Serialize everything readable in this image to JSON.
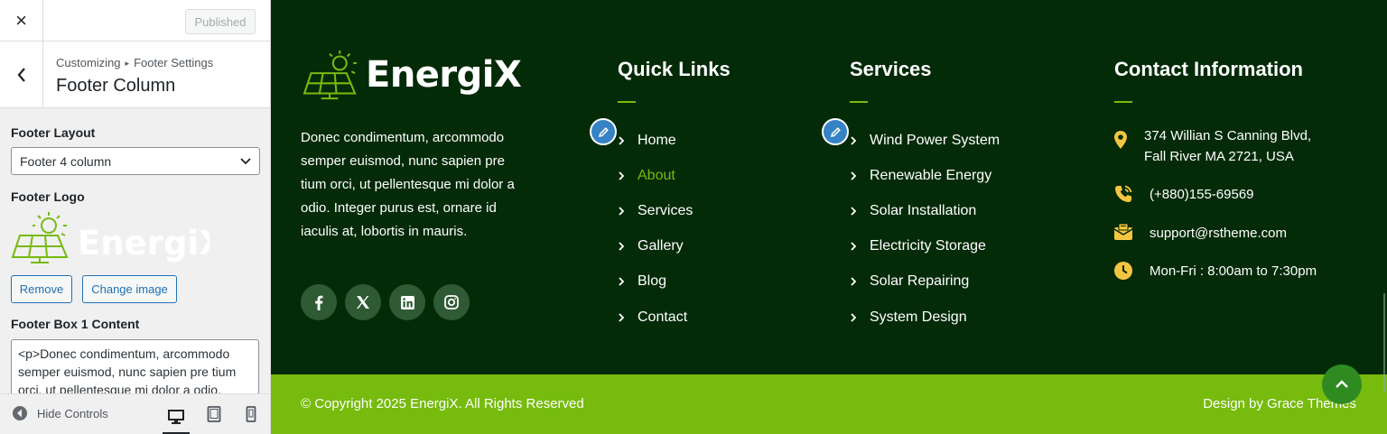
{
  "sidebar": {
    "close_label": "×",
    "publish_label": "Published",
    "breadcrumb_root": "Customizing",
    "breadcrumb_parent": "Footer Settings",
    "section_title": "Footer Column",
    "layout_label": "Footer Layout",
    "layout_value": "Footer 4 column",
    "logo_label": "Footer Logo",
    "logo_text": "EnergiX",
    "remove_label": "Remove",
    "change_image_label": "Change image",
    "box1_label": "Footer Box 1 Content",
    "box1_value": "<p>Donec condimentum, arcommodo semper euismod, nunc sapien pre tium orci, ut pellentesque mi dolor a odio.",
    "hide_controls_label": "Hide Controls",
    "active_device": "desktop"
  },
  "footer": {
    "brand": "EnergiX",
    "about": "Donec condimentum, arcommodo semper euismod, nunc sapien pre tium orci, ut pellentesque mi dolor a odio. Integer purus est, ornare id iaculis at, lobortis in mauris.",
    "socials": [
      "facebook-icon",
      "x-twitter-icon",
      "linkedin-icon",
      "instagram-icon"
    ],
    "quick_links": {
      "title": "Quick Links",
      "items": [
        "Home",
        "About",
        "Services",
        "Gallery",
        "Blog",
        "Contact"
      ],
      "active": "About"
    },
    "services": {
      "title": "Services",
      "items": [
        "Wind Power System",
        "Renewable Energy",
        "Solar Installation",
        "Electricity Storage",
        "Solar Repairing",
        "System Design"
      ]
    },
    "contact": {
      "title": "Contact Information",
      "address_line1": "374 Willian S Canning Blvd,",
      "address_line2": "Fall River MA 2721, USA",
      "phone": "(+880)155-69569",
      "email": "support@rstheme.com",
      "hours": "Mon-Fri : 8:00am to 7:30pm"
    },
    "copyright": "© Copyright 2025 EnergiX. All Rights Reserved",
    "design_by": "Design by Grace Themes"
  },
  "colors": {
    "footer_bg": "#042b08",
    "accent": "#76bb0e",
    "icon_yellow": "#f5c542",
    "edit_blue": "#3582c4"
  }
}
